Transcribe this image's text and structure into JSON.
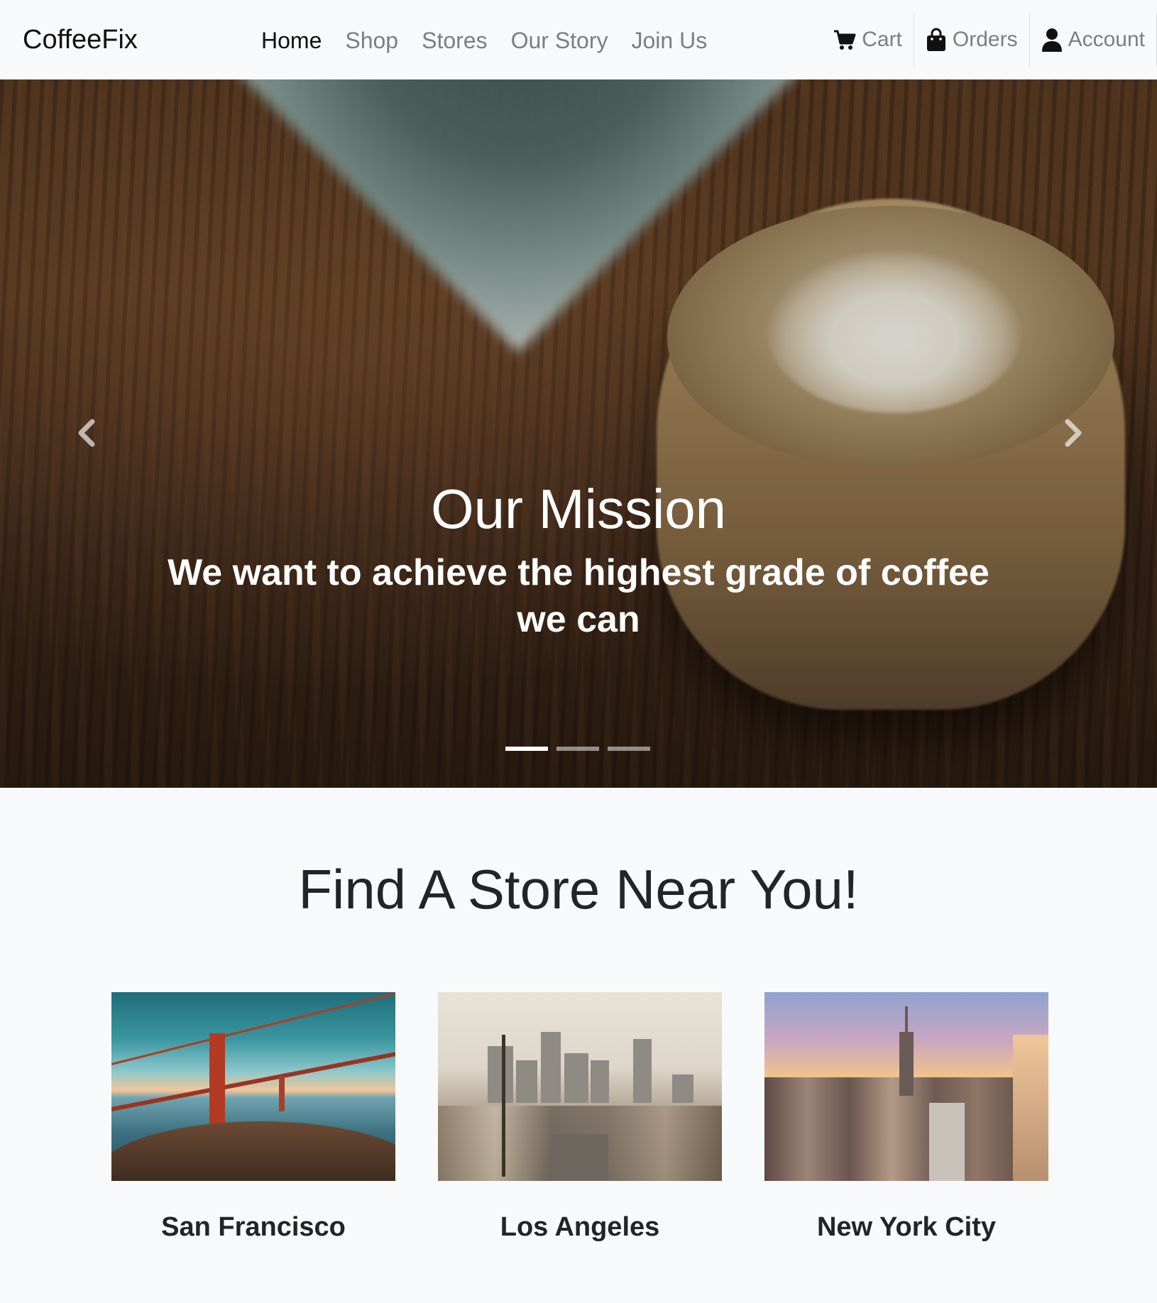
{
  "brand": "CoffeeFix",
  "nav": {
    "links": [
      "Home",
      "Shop",
      "Stores",
      "Our Story",
      "Join Us"
    ],
    "active": "Home",
    "cart": "Cart",
    "orders": "Orders",
    "account": "Account"
  },
  "carousel": {
    "title": "Our Mission",
    "text": "We want to achieve the highest grade of coffee we can",
    "slide_count": 3,
    "active_slide": 1
  },
  "stores": {
    "title": "Find A Store Near You!",
    "items": [
      {
        "name": "San Francisco"
      },
      {
        "name": "Los Angeles"
      },
      {
        "name": "New York City"
      }
    ]
  },
  "colors": {
    "nav_bg": "#f8f9fa",
    "nav_text": "#7b7f84",
    "nav_active": "#111111",
    "page_bg": "#f8f9fa",
    "caption_text": "#ffffff"
  }
}
